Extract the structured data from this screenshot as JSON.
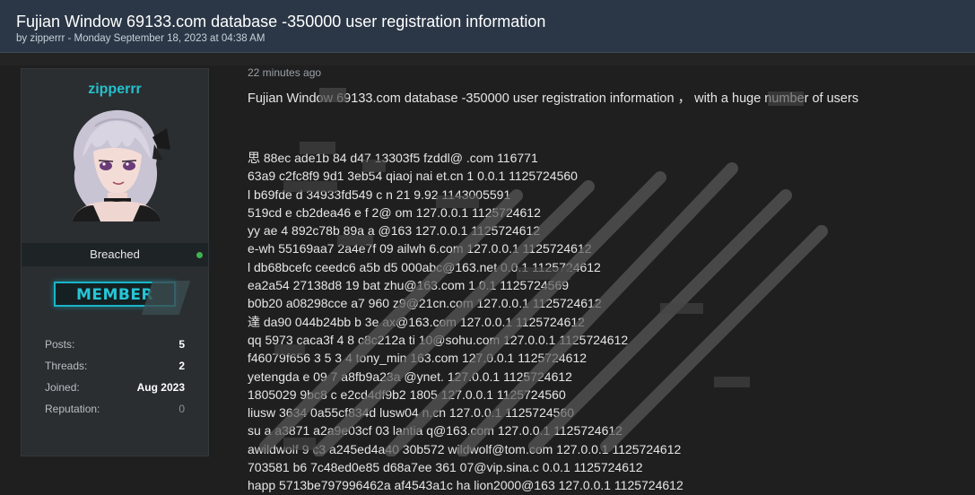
{
  "thread": {
    "title": "Fujian Window 69133.com database -350000 user registration information",
    "meta": "by zipperrr - Monday September 18, 2023 at 04:38 AM"
  },
  "user": {
    "name": "zipperrr",
    "avatar_icon": "anime-character-avatar",
    "rank": "Breached",
    "status_color": "#3fb34f",
    "badge": "MEMBER",
    "stats": [
      {
        "label": "Posts:",
        "value": "5"
      },
      {
        "label": "Threads:",
        "value": "2"
      },
      {
        "label": "Joined:",
        "value": "Aug 2023"
      },
      {
        "label": "Reputation:",
        "value": "0"
      }
    ]
  },
  "post": {
    "time": "22 minutes ago",
    "lead": "Fujian Window 69133.com database -350000 user registration information ， with a huge number of users",
    "lines": [
      "思 88ec   ade1b  84   d47   13303f5 fzddl@     .com 116771     ",
      "63a9   c2fc8f9    9d1    3eb54 qiaoj     nai    et.cn 1    0.0.1 1125724560",
      "l     b69fde     d      34933fd549    c       n 21      9.92 1143005591",
      "  519cd      e      cb2dea46     e    f      2@     om 127.0.0.1 1125724612",
      "yy ae     4     892c78b    89a    a      @163     127.0.0.1 1125724612",
      "e-wh     55169aa7   2a4e7f     09     ailwh     6.com 127.0.0.1 1125724612",
      "l     db68bcefc     ceedc6    a5b     d5     000abc@163.net     0.0.1 1125724612",
      "      ea2a54    27138d8     19     bat      zhu@163.com 1     0.1 1125724569",
      "  b0b20     a08298cce     a7       960    z9@21cn.com 127.0.0.1 1125724612",
      "達 da90    044b24bb      b       3e     ax@163.com 127.0.0.1 1125724612",
      "qq   5973 caca3f      4     8       c8c212a ti    10@sohu.com 127.0.0.1 1125724612",
      "  f46079f656     3     5     3     4 tony_min    163.com 127.0.0.1 1125724612",
      "yetengda e     09     7      a8fb9a23a     @ynet.     127.0.0.1 1125724612",
      "1805029     9bc8     c     e2cd4df9b2     1805     127.0.0.1 1125724560",
      "liusw     3634     0a55cf834d     lusw04     n.cn 127.0.0.1 1125724560",
      "su   a a3871     a2a9e03cf    03 lantia   q@163.com 127.0.0.1 1125724612",
      "awildwolf 9     c3    a245ed4a40     30b572     wildwolf@tom.com 127.0.0.1 1125724612",
      "703581     b6    7c48ed0e85     d68a7ee    361     07@vip.sina.c     0.0.1 1125724612",
      "happ     5713be797996462a     af4543a1c    ha     lion2000@163     127.0.0.1 1125724612"
    ]
  }
}
